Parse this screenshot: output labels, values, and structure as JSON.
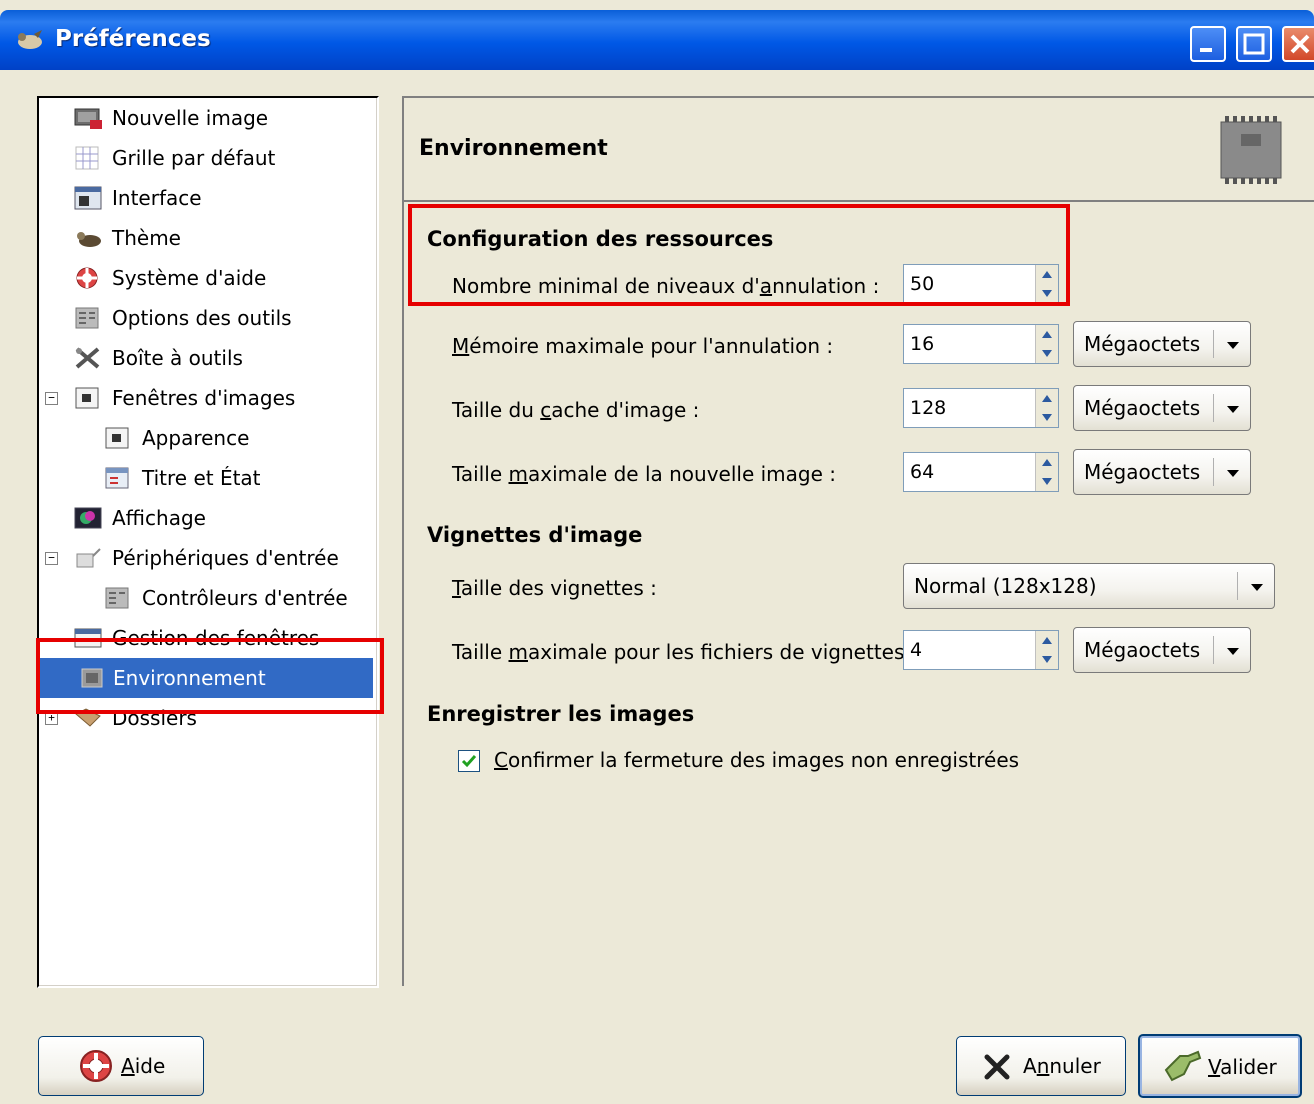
{
  "window": {
    "title": "Préférences"
  },
  "tree": {
    "items": [
      {
        "label": "Nouvelle image",
        "icon": "new-image-icon"
      },
      {
        "label": "Grille par défaut",
        "icon": "grid-icon"
      },
      {
        "label": "Interface",
        "icon": "interface-icon"
      },
      {
        "label": "Thème",
        "icon": "theme-icon"
      },
      {
        "label": "Système d'aide",
        "icon": "help-system-icon"
      },
      {
        "label": "Options des outils",
        "icon": "tool-options-icon"
      },
      {
        "label": "Boîte à outils",
        "icon": "toolbox-icon"
      },
      {
        "label": "Fenêtres d'images",
        "icon": "image-windows-icon",
        "expander": "−"
      },
      {
        "label": "Apparence",
        "icon": "appearance-icon"
      },
      {
        "label": "Titre et État",
        "icon": "title-status-icon"
      },
      {
        "label": "Affichage",
        "icon": "display-icon"
      },
      {
        "label": "Périphériques d'entrée",
        "icon": "input-devices-icon",
        "expander": "−"
      },
      {
        "label": "Contrôleurs d'entrée",
        "icon": "input-controllers-icon"
      },
      {
        "label": "Gestion des fenêtres",
        "icon": "window-management-icon"
      },
      {
        "label": "Environnement",
        "icon": "environment-icon",
        "selected": true
      },
      {
        "label": "Dossiers",
        "icon": "folders-icon",
        "expander": "+"
      }
    ]
  },
  "panel": {
    "title": "Environnement",
    "header_icon": "ram-icon",
    "sections": {
      "resources": {
        "title": "Configuration des ressources",
        "undo_levels": {
          "label_pre": "Nombre minimal de niveaux d'",
          "label_u": "a",
          "label_post": "nnulation :",
          "value": "50"
        },
        "undo_memory": {
          "label_u": "M",
          "label_post": "émoire maximale pour l'annulation :",
          "value": "16",
          "unit": "Mégaoctets"
        },
        "tile_cache": {
          "label_pre": "Taille du ",
          "label_u": "c",
          "label_post": "ache d'image :",
          "value": "128",
          "unit": "Mégaoctets"
        },
        "max_new_image": {
          "label_pre": "Taille ",
          "label_u": "m",
          "label_post": "aximale de la nouvelle image :",
          "value": "64",
          "unit": "Mégaoctets"
        }
      },
      "thumbnails": {
        "title": "Vignettes d'image",
        "size": {
          "label_u": "T",
          "label_post": "aille des vignettes :",
          "value": "Normal (128x128)"
        },
        "max_filesize": {
          "label_pre": "Taille ",
          "label_u": "m",
          "label_post": "aximale pour les fichiers de vignettes :",
          "value": "4",
          "unit": "Mégaoctets"
        }
      },
      "saving": {
        "title": "Enregistrer les images",
        "confirm": {
          "label_u": "C",
          "label_post": "onfirmer la fermeture des images non enregistrées",
          "checked": true
        }
      }
    }
  },
  "buttons": {
    "help": {
      "label_u": "A",
      "label_post": "ide"
    },
    "cancel": {
      "label_pre": "A",
      "label_u": "n",
      "label_post": "nuler"
    },
    "ok": {
      "label_u": "V",
      "label_post": "alider"
    }
  },
  "colors": {
    "titlebar": "#0058e6",
    "selection": "#316ac5",
    "highlight": "#e60000"
  }
}
